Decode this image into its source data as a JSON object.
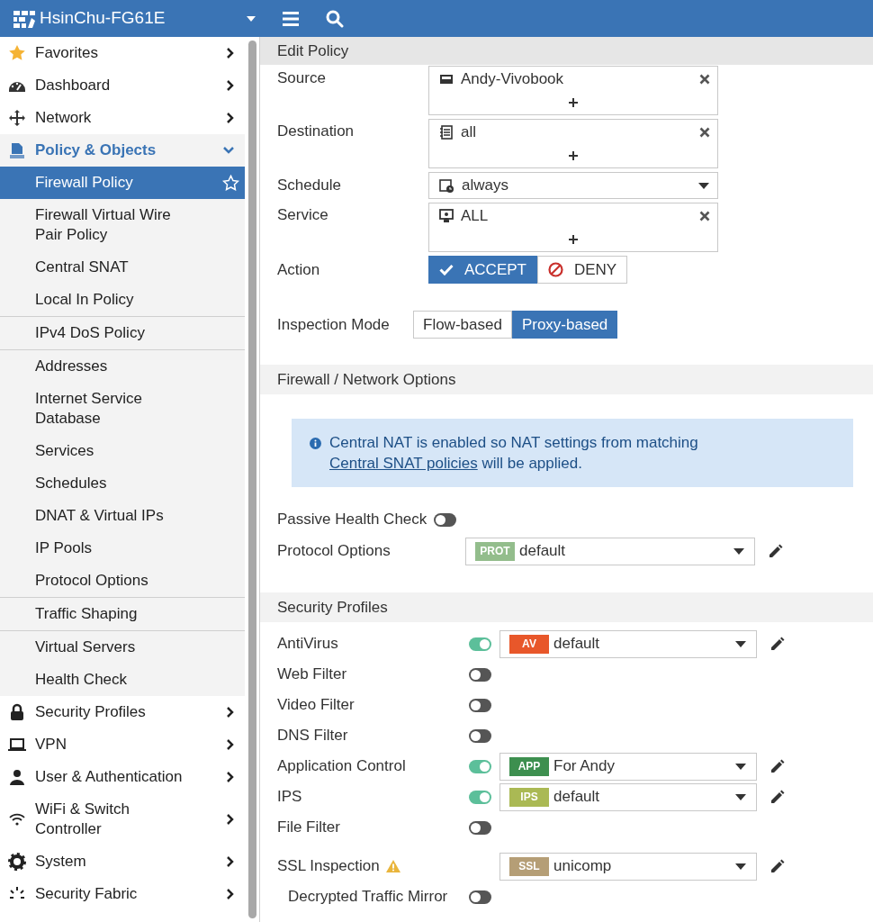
{
  "header": {
    "title": "HsinChu-FG61E"
  },
  "sidebar": {
    "items": [
      {
        "label": "Favorites",
        "expanded": false
      },
      {
        "label": "Dashboard",
        "expanded": false
      },
      {
        "label": "Network",
        "expanded": false
      },
      {
        "label": "Policy & Objects",
        "expanded": true,
        "groups": [
          [
            {
              "label": "Firewall Policy",
              "selected": true
            },
            {
              "label": "Firewall Virtual Wire Pair Policy",
              "selected": false
            },
            {
              "label": "Central SNAT",
              "selected": false
            },
            {
              "label": "Local In Policy",
              "selected": false
            }
          ],
          [
            {
              "label": "IPv4 DoS Policy",
              "selected": false
            }
          ],
          [
            {
              "label": "Addresses",
              "selected": false
            },
            {
              "label": "Internet Service Database",
              "selected": false
            },
            {
              "label": "Services",
              "selected": false
            },
            {
              "label": "Schedules",
              "selected": false
            },
            {
              "label": "DNAT & Virtual IPs",
              "selected": false
            },
            {
              "label": "IP Pools",
              "selected": false
            },
            {
              "label": "Protocol Options",
              "selected": false
            }
          ],
          [
            {
              "label": "Traffic Shaping",
              "selected": false
            }
          ],
          [
            {
              "label": "Virtual Servers",
              "selected": false
            },
            {
              "label": "Health Check",
              "selected": false
            }
          ]
        ]
      },
      {
        "label": "Security Profiles",
        "expanded": false
      },
      {
        "label": "VPN",
        "expanded": false
      },
      {
        "label": "User & Authentication",
        "expanded": false
      },
      {
        "label": "WiFi & Switch Controller",
        "expanded": false
      },
      {
        "label": "System",
        "expanded": false
      },
      {
        "label": "Security Fabric",
        "expanded": false
      }
    ]
  },
  "form": {
    "title": "Edit Policy",
    "fields": [
      {
        "kind": "multi",
        "label": "Source",
        "values": [
          "Andy-Vivobook"
        ]
      },
      {
        "kind": "multi",
        "label": "Destination",
        "values": [
          "all"
        ]
      },
      {
        "kind": "select",
        "label": "Schedule",
        "value": "always"
      },
      {
        "kind": "multi",
        "label": "Service",
        "values": [
          "ALL"
        ]
      },
      {
        "kind": "action",
        "label": "Action",
        "options": [
          {
            "label": "ACCEPT",
            "selected": true
          },
          {
            "label": "DENY",
            "selected": false
          }
        ]
      },
      {
        "kind": "segmented",
        "label": "Inspection Mode",
        "options": [
          {
            "label": "Flow-based",
            "selected": false
          },
          {
            "label": "Proxy-based",
            "selected": true
          }
        ]
      }
    ],
    "sections": [
      {
        "title": "Firewall / Network Options",
        "notice": {
          "before": "Central NAT is enabled so NAT settings from matching",
          "link": "Central SNAT policies",
          "after": "will be applied."
        },
        "rows": [
          {
            "kind": "toggle",
            "label": "Passive Health Check",
            "on": false
          },
          {
            "kind": "select",
            "label": "Protocol Options",
            "badge": "PROT",
            "color": "#93bd8c",
            "value": "default"
          }
        ]
      },
      {
        "title": "Security Profiles",
        "rows": [
          {
            "kind": "profile",
            "label": "AntiVirus",
            "on": true,
            "badge": "AV",
            "color": "#e8572a",
            "value": "default"
          },
          {
            "kind": "profile",
            "label": "Web Filter",
            "on": false
          },
          {
            "kind": "profile",
            "label": "Video Filter",
            "on": false
          },
          {
            "kind": "profile",
            "label": "DNS Filter",
            "on": false
          },
          {
            "kind": "profile",
            "label": "Application Control",
            "on": true,
            "badge": "APP",
            "color": "#3d8f4f",
            "value": "For Andy"
          },
          {
            "kind": "profile",
            "label": "IPS",
            "on": true,
            "badge": "IPS",
            "color": "#aab954",
            "value": "default"
          },
          {
            "kind": "profile",
            "label": "File Filter",
            "on": false
          },
          {
            "kind": "profile",
            "label": "SSL Inspection",
            "warning": true,
            "badge": "SSL",
            "color": "#b59e76",
            "value": "unicomp",
            "children": [
              {
                "kind": "profile",
                "label": "Decrypted Traffic Mirror",
                "on": false
              }
            ]
          }
        ]
      }
    ]
  }
}
